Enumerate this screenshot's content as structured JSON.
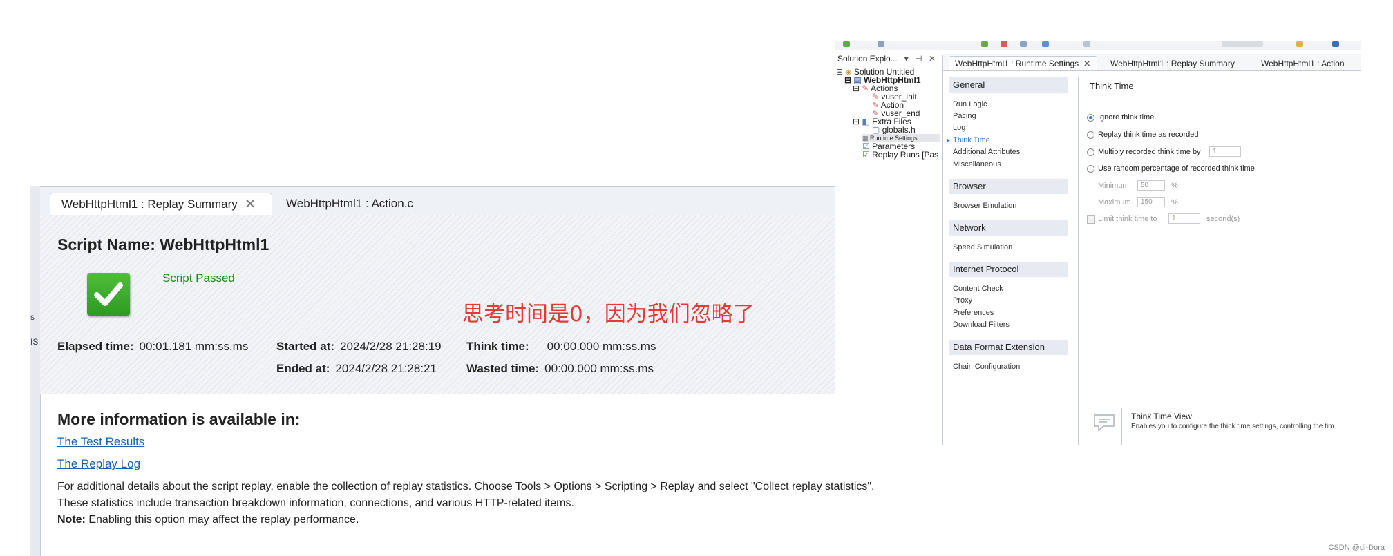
{
  "replay_summary": {
    "tabs": [
      {
        "label": "WebHttpHtml1 : Replay Summary",
        "active": true
      },
      {
        "label": "WebHttpHtml1 : Action.c",
        "active": false
      }
    ],
    "left_strip_marks": [
      "s",
      "IS"
    ],
    "script_name_label": "Script Name:",
    "script_name": "WebHttpHtml1",
    "status": "Script Passed",
    "annotation": "思考时间是0，因为我们忽略了",
    "elapsed_label": "Elapsed time:",
    "elapsed_value": "00:01.181 mm:ss.ms",
    "started_label": "Started at:",
    "started_value": "2024/2/28 21:28:19",
    "ended_label": "Ended at:",
    "ended_value": "2024/2/28 21:28:21",
    "think_label": "Think time:",
    "think_value": "00:00.000 mm:ss.ms",
    "wasted_label": "Wasted time:",
    "wasted_value": "00:00.000 mm:ss.ms",
    "more_info_heading": "More information is available in:",
    "link_test_results": "The Test Results",
    "link_replay_log": "The Replay Log",
    "details_line1": "For additional details about the script replay, enable the collection of replay statistics. Choose Tools > Options > Scripting > Replay and select \"Collect replay statistics\".",
    "details_line2": "These statistics include transaction breakdown information, connections, and various HTTP-related items.",
    "note_label": "Note:",
    "note_text": "Enabling this option may affect the replay performance."
  },
  "solution_explorer": {
    "header": "Solution Explo...",
    "header_controls": "▾ ⊣ ✕",
    "tree": [
      {
        "label": "Solution Untitled",
        "icon": "solution-icon"
      },
      {
        "label": "WebHttpHtml1",
        "icon": "script-icon",
        "bold": true
      },
      {
        "label": "Actions",
        "icon": "actions-folder-icon"
      },
      {
        "label": "vuser_init",
        "icon": "action-file-icon"
      },
      {
        "label": "Action",
        "icon": "action-file-icon"
      },
      {
        "label": "vuser_end",
        "icon": "action-file-icon"
      },
      {
        "label": "Extra Files",
        "icon": "folder-icon"
      },
      {
        "label": "globals.h",
        "icon": "file-icon"
      },
      {
        "label": "Runtime Settings",
        "icon": "settings-icon"
      },
      {
        "label": "Parameters",
        "icon": "parameters-icon"
      },
      {
        "label": "Replay Runs [Pas",
        "icon": "replay-passed-icon"
      }
    ]
  },
  "runtime_settings": {
    "tabs": [
      {
        "label": "WebHttpHtml1 : Runtime Settings",
        "active": true
      },
      {
        "label": "WebHttpHtml1 : Replay Summary",
        "active": false
      },
      {
        "label": "WebHttpHtml1 : Action",
        "active": false
      }
    ],
    "groups": [
      {
        "title": "General",
        "items": [
          "Run Logic",
          "Pacing",
          "Log",
          "Think Time",
          "Additional Attributes",
          "Miscellaneous"
        ]
      },
      {
        "title": "Browser",
        "items": [
          "Browser Emulation"
        ]
      },
      {
        "title": "Network",
        "items": [
          "Speed Simulation"
        ]
      },
      {
        "title": "Internet Protocol",
        "items": [
          "Content Check",
          "Proxy",
          "Preferences",
          "Download Filters"
        ]
      },
      {
        "title": "Data Format Extension",
        "items": [
          "Chain Configuration"
        ]
      }
    ],
    "active_item": "Think Time",
    "panel_title": "Think Time",
    "options": [
      {
        "label": "Ignore think time",
        "selected": true
      },
      {
        "label": "Replay think time as recorded",
        "selected": false
      },
      {
        "label": "Multiply recorded think time by",
        "selected": false,
        "value": "1"
      },
      {
        "label": "Use random percentage of recorded think time",
        "selected": false
      }
    ],
    "min_label": "Minimum",
    "min_value": "50",
    "max_label": "Maximum",
    "max_value": "150",
    "percent": "%",
    "limit_label": "Limit think time to",
    "limit_value": "1",
    "limit_unit": "second(s)",
    "view_title": "Think Time View",
    "view_desc": "Enables you to configure the think time settings, controlling the tim"
  },
  "watermark": "CSDN @di-Dora"
}
